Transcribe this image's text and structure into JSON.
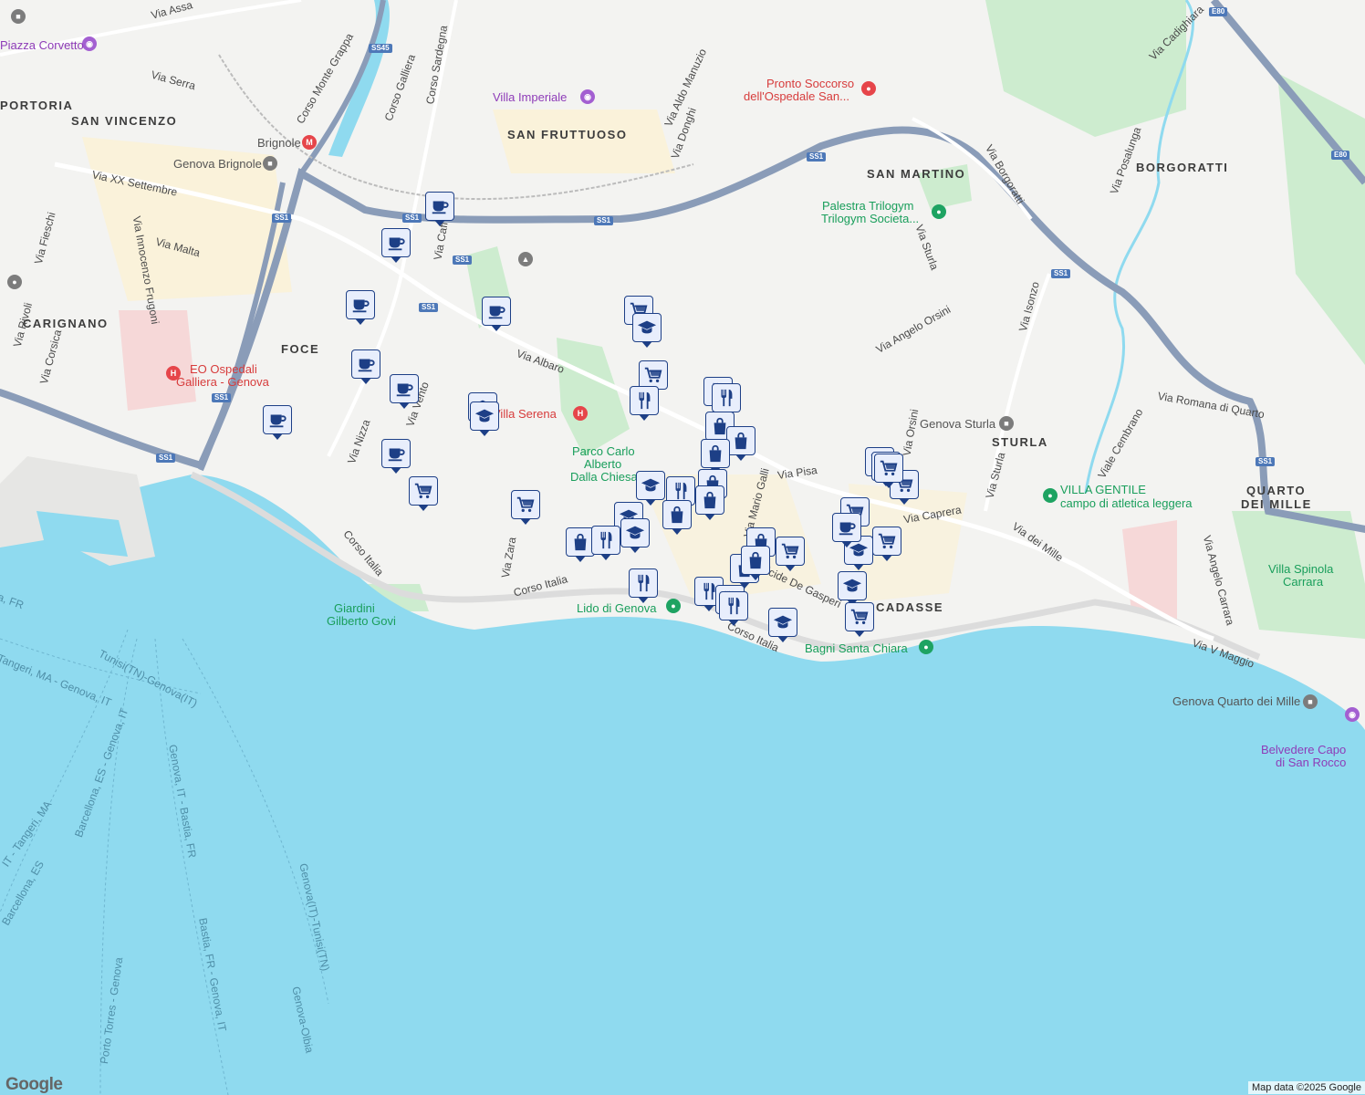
{
  "map": {
    "attribution": "Map data ©2025 Google",
    "logo": "Google",
    "colors": {
      "sea": "#8fdaef",
      "land": "#f3f3f1",
      "park": "#cdeccf",
      "urban": "#fbf1d4",
      "highway": "#8a9cb8",
      "marker_fill": "#e8eefc",
      "marker_stroke": "#1d3f86"
    }
  },
  "areas": [
    {
      "id": "portoria",
      "text": "PORTORIA"
    },
    {
      "id": "san-vincenzo",
      "text": "SAN VINCENZO"
    },
    {
      "id": "san-fruttuoso",
      "text": "SAN FRUTTUOSO"
    },
    {
      "id": "san-martino",
      "text": "SAN MARTINO"
    },
    {
      "id": "borgoratti",
      "text": "BORGORATTI"
    },
    {
      "id": "carignano",
      "text": "CARIGNANO"
    },
    {
      "id": "foce",
      "text": "FOCE"
    },
    {
      "id": "sturla",
      "text": "STURLA"
    },
    {
      "id": "quarto-1",
      "text": "QUARTO"
    },
    {
      "id": "quarto-2",
      "text": "DEI MILLE"
    },
    {
      "id": "vernazzola",
      "text": "CADASSE"
    }
  ],
  "streets": [
    {
      "id": "via-assarotti",
      "text": "Via Assa"
    },
    {
      "id": "corso-monte-grappa",
      "text": "Corso Monte Grappa"
    },
    {
      "id": "corso-galliera",
      "text": "Corso Galliera"
    },
    {
      "id": "corso-sardegna",
      "text": "Corso Sardegna"
    },
    {
      "id": "via-serra",
      "text": "Via Serra"
    },
    {
      "id": "via-xx-settembre",
      "text": "Via XX Settembre"
    },
    {
      "id": "via-fieschi",
      "text": "Via Fieschi"
    },
    {
      "id": "via-innocenzo",
      "text": "Via Innocenzo Frugoni"
    },
    {
      "id": "via-malta",
      "text": "Via Malta"
    },
    {
      "id": "via-caffaro",
      "text": "Via Caff"
    },
    {
      "id": "via-aldo-manuzio",
      "text": "Via Aldo Manuzio"
    },
    {
      "id": "via-donghi",
      "text": "Via Donghi"
    },
    {
      "id": "via-borgoratti",
      "text": "Via Borgoratti"
    },
    {
      "id": "via-posalunga",
      "text": "Via Posalunga"
    },
    {
      "id": "via-cadighiara",
      "text": "Via Cadighiara"
    },
    {
      "id": "via-sturla-n",
      "text": "Via Sturla"
    },
    {
      "id": "via-angelo-orsini",
      "text": "Via Angelo Orsini"
    },
    {
      "id": "via-isonzo",
      "text": "Via Isonzo"
    },
    {
      "id": "via-romana",
      "text": "Via Romana di Quarto"
    },
    {
      "id": "viale-cembrano",
      "text": "Viale Cembrano"
    },
    {
      "id": "via-sturla-s",
      "text": "Via Sturla"
    },
    {
      "id": "via-caprera",
      "text": "Via Caprera"
    },
    {
      "id": "via-dei-mille",
      "text": "Via dei Mille"
    },
    {
      "id": "via-angelo-carrara",
      "text": "Via Angelo Carrara"
    },
    {
      "id": "via-v-maggio",
      "text": "Via V Maggio"
    },
    {
      "id": "via-albaro",
      "text": "Via Albaro"
    },
    {
      "id": "via-pisa",
      "text": "Via Pisa"
    },
    {
      "id": "via-mario-galli",
      "text": "Via Mario Galli"
    },
    {
      "id": "via-nizza",
      "text": "Via Nizza"
    },
    {
      "id": "via-vento",
      "text": "Via Vento"
    },
    {
      "id": "via-zara",
      "text": "Via Zara"
    },
    {
      "id": "corso-italia-w",
      "text": "Corso Italia"
    },
    {
      "id": "corso-italia-c",
      "text": "Corso Italia"
    },
    {
      "id": "corso-italia-e",
      "text": "Corso Italia"
    },
    {
      "id": "via-de-gasperi",
      "text": "Via Alcide De Gasperi"
    },
    {
      "id": "via-rivoli",
      "text": "Via Rivoli"
    },
    {
      "id": "via-corsica",
      "text": "Via Corsica"
    },
    {
      "id": "via-orsini-s",
      "text": "Via Orsini"
    }
  ],
  "pois": [
    {
      "id": "piazza-corvetto",
      "text": "Piazza Corvetto",
      "color": "purple",
      "icon": "camera-icon"
    },
    {
      "id": "villa-imperiale",
      "text": "Villa Imperiale",
      "color": "purple",
      "icon": "camera-icon"
    },
    {
      "id": "pronto-soccorso-1",
      "text": "Pronto Soccorso",
      "color": "red",
      "icon": "pin-icon"
    },
    {
      "id": "pronto-soccorso-2",
      "text": "dell'Ospedale San...",
      "color": "red",
      "icon": "pin-icon"
    },
    {
      "id": "brignole",
      "text": "Brignole",
      "color": "gray",
      "icon": "metro-icon"
    },
    {
      "id": "genova-brignole",
      "text": "Genova Brignole",
      "color": "gray",
      "icon": "train-icon"
    },
    {
      "id": "palestra-1",
      "text": "Palestra Trilogym",
      "color": "green",
      "icon": "pin-icon"
    },
    {
      "id": "palestra-2",
      "text": "Trilogym Societa...",
      "color": "green",
      "icon": "pin-icon"
    },
    {
      "id": "eo-ospedali-1",
      "text": "EO Ospedali",
      "color": "red",
      "icon": "hospital-icon"
    },
    {
      "id": "eo-ospedali-2",
      "text": "Galliera - Genova",
      "color": "red",
      "icon": "hospital-icon"
    },
    {
      "id": "villa-serena",
      "text": "Villa Serena",
      "color": "red",
      "icon": "hospital-icon"
    },
    {
      "id": "parco-1",
      "text": "Parco Carlo",
      "color": "green",
      "icon": "park-icon"
    },
    {
      "id": "parco-2",
      "text": "Alberto",
      "color": "green",
      "icon": "park-icon"
    },
    {
      "id": "parco-3",
      "text": "Dalla Chiesa",
      "color": "green",
      "icon": "park-icon"
    },
    {
      "id": "genova-sturla",
      "text": "Genova Sturla",
      "color": "gray",
      "icon": "train-icon"
    },
    {
      "id": "villa-gentile-1",
      "text": "VILLA GENTILE",
      "color": "green",
      "icon": "pin-icon"
    },
    {
      "id": "villa-gentile-2",
      "text": "campo di atletica leggera",
      "color": "green",
      "icon": "pin-icon"
    },
    {
      "id": "villa-spinola-1",
      "text": "Villa Spinola",
      "color": "green",
      "icon": "park-icon"
    },
    {
      "id": "villa-spinola-2",
      "text": "Carrara",
      "color": "green",
      "icon": "park-icon"
    },
    {
      "id": "giardini-1",
      "text": "Giardini",
      "color": "green",
      "icon": "park-icon"
    },
    {
      "id": "giardini-2",
      "text": "Gilberto Govi",
      "color": "green",
      "icon": "park-icon"
    },
    {
      "id": "lido",
      "text": "Lido di Genova",
      "color": "green",
      "icon": "pin-icon"
    },
    {
      "id": "bagni",
      "text": "Bagni Santa Chiara",
      "color": "green",
      "icon": "pin-icon"
    },
    {
      "id": "quarto-station",
      "text": "Genova Quarto dei Mille",
      "color": "gray",
      "icon": "train-icon"
    },
    {
      "id": "belvedere-1",
      "text": "Belvedere Capo",
      "color": "purple",
      "icon": "camera-icon"
    },
    {
      "id": "belvedere-2",
      "text": "di San Rocco",
      "color": "purple",
      "icon": "camera-icon"
    }
  ],
  "ferries": [
    {
      "id": "f1",
      "text": "Tangeri, MA - Genova, IT"
    },
    {
      "id": "f2",
      "text": "Tunisi(TN)-Genova(IT)"
    },
    {
      "id": "f3",
      "text": "Barcellona, ES - Genova, IT"
    },
    {
      "id": "f4",
      "text": "Genova, IT - Bastia, FR"
    },
    {
      "id": "f5",
      "text": "Bastia, FR - Genova, IT"
    },
    {
      "id": "f6",
      "text": "Genova(IT)-Tunisi(TN)"
    },
    {
      "id": "f7",
      "text": "Genova-Olbia"
    },
    {
      "id": "f8",
      "text": "Porto Torres - Genova"
    },
    {
      "id": "f9",
      "text": "IT - Tangeri, MA"
    },
    {
      "id": "f10",
      "text": "Barcellona, ES"
    },
    {
      "id": "f11",
      "text": "a, FR"
    }
  ],
  "shields": [
    {
      "id": "ss45",
      "text": "SS45"
    },
    {
      "id": "ss1-a",
      "text": "SS1"
    },
    {
      "id": "ss1-b",
      "text": "SS1"
    },
    {
      "id": "ss1-c",
      "text": "SS1"
    },
    {
      "id": "ss1-d",
      "text": "SS1"
    },
    {
      "id": "ss1-e",
      "text": "SS1"
    },
    {
      "id": "ss1-f",
      "text": "SS1"
    },
    {
      "id": "ss1-g",
      "text": "SS1"
    },
    {
      "id": "ss1-h",
      "text": "SS1"
    },
    {
      "id": "ss1-i",
      "text": "SS1"
    },
    {
      "id": "ss1-j",
      "text": "SS1"
    },
    {
      "id": "e80-a",
      "text": "E80"
    },
    {
      "id": "e80-b",
      "text": "E80"
    }
  ],
  "markers": [
    {
      "type": "cafe"
    },
    {
      "type": "cafe"
    },
    {
      "type": "cafe"
    },
    {
      "type": "cafe"
    },
    {
      "type": "cafe"
    },
    {
      "type": "cafe"
    },
    {
      "type": "cafe"
    },
    {
      "type": "cafe"
    },
    {
      "type": "school"
    },
    {
      "type": "cart"
    },
    {
      "type": "cart"
    },
    {
      "type": "cart"
    },
    {
      "type": "cart"
    },
    {
      "type": "school"
    },
    {
      "type": "cart"
    },
    {
      "type": "restaurant"
    },
    {
      "type": "restaurant"
    },
    {
      "type": "restaurant"
    },
    {
      "type": "shopping"
    },
    {
      "type": "shopping"
    },
    {
      "type": "shopping"
    },
    {
      "type": "school"
    },
    {
      "type": "restaurant"
    },
    {
      "type": "shopping"
    },
    {
      "type": "shopping"
    },
    {
      "type": "shopping"
    },
    {
      "type": "school"
    },
    {
      "type": "school"
    },
    {
      "type": "shopping"
    },
    {
      "type": "restaurant"
    },
    {
      "type": "restaurant"
    },
    {
      "type": "restaurant"
    },
    {
      "type": "restaurant"
    },
    {
      "type": "restaurant"
    },
    {
      "type": "shopping"
    },
    {
      "type": "shopping"
    },
    {
      "type": "cart"
    },
    {
      "type": "shopping"
    },
    {
      "type": "school"
    },
    {
      "type": "cart"
    },
    {
      "type": "cart"
    },
    {
      "type": "cart"
    },
    {
      "type": "cart"
    },
    {
      "type": "cafe"
    },
    {
      "type": "school"
    },
    {
      "type": "cart"
    },
    {
      "type": "school"
    },
    {
      "type": "cart"
    },
    {
      "type": "school"
    }
  ]
}
